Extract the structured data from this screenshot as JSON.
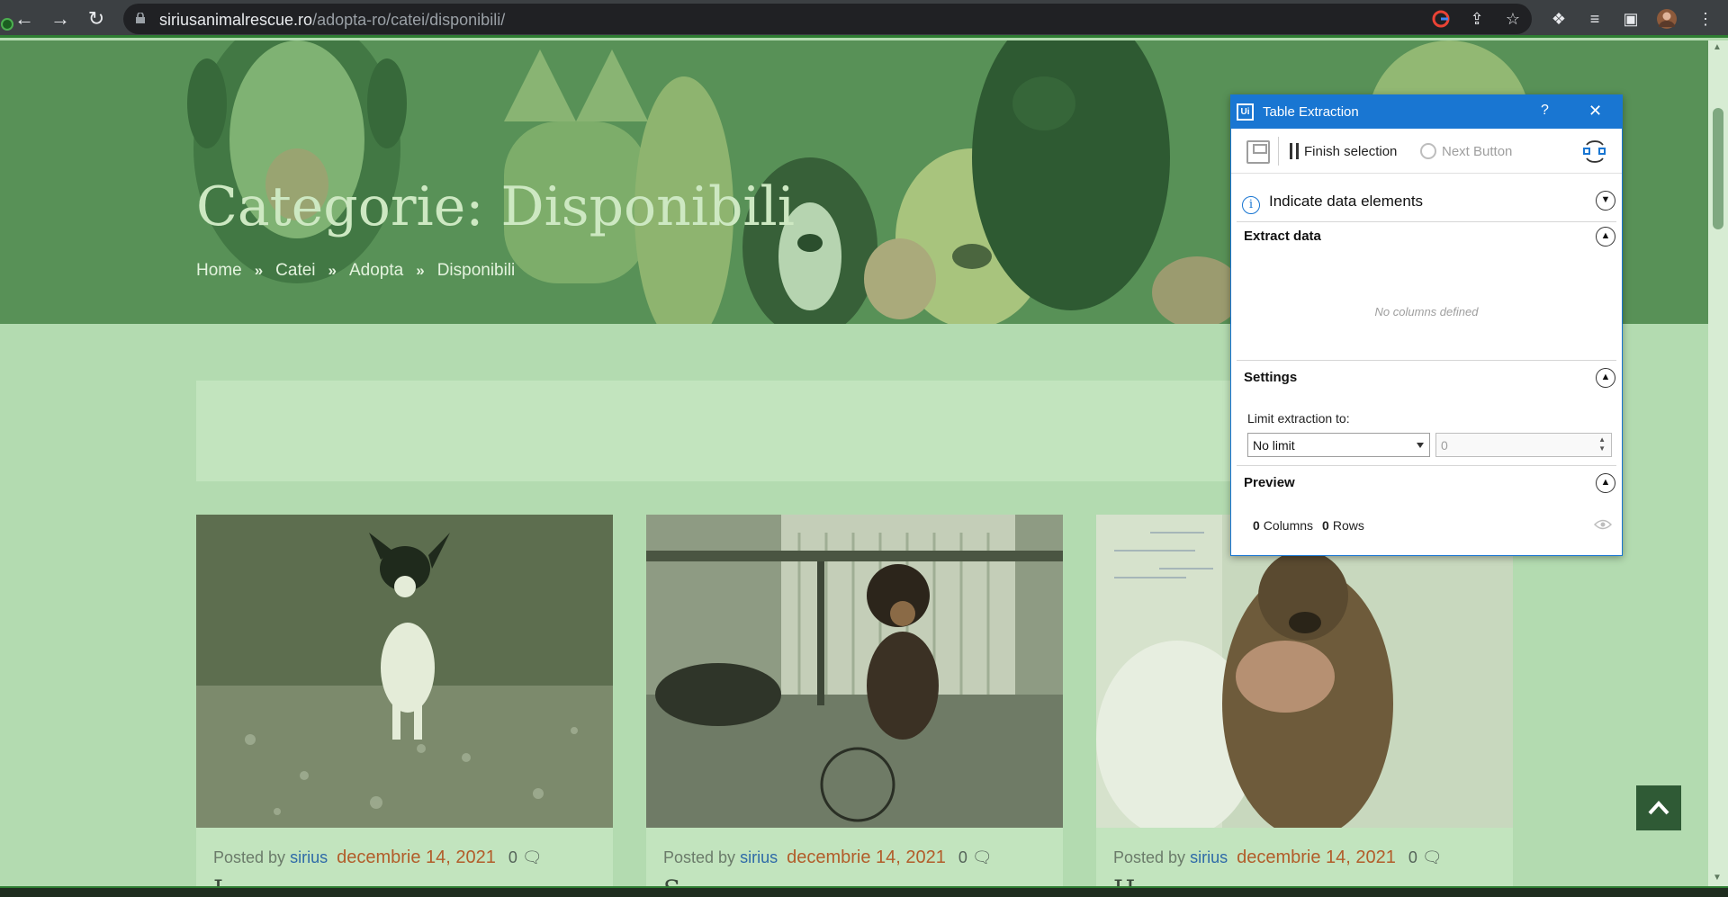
{
  "browser": {
    "url_host": "siriusanimalrescue.ro",
    "url_path": "/adopta-ro/catei/disponibili/"
  },
  "hero": {
    "title": "Categorie: Disponibili",
    "breadcrumbs": [
      "Home",
      "Catei",
      "Adopta",
      "Disponibili"
    ]
  },
  "posts": [
    {
      "posted_by": "Posted by",
      "author": "sirius",
      "date": "decembrie 14, 2021",
      "comments": "0",
      "title_start": "L"
    },
    {
      "posted_by": "Posted by",
      "author": "sirius",
      "date": "decembrie 14, 2021",
      "comments": "0",
      "title_start": "S"
    },
    {
      "posted_by": "Posted by",
      "author": "sirius",
      "date": "decembrie 14, 2021",
      "comments": "0",
      "title_start": "H"
    }
  ],
  "dialog": {
    "title": "Table Extraction",
    "help": "?",
    "finish_selection": "Finish selection",
    "next_button": "Next Button",
    "indicate": "Indicate data elements",
    "extract_data": "Extract data",
    "no_columns": "No columns defined",
    "settings": "Settings",
    "limit_label": "Limit extraction to:",
    "limit_value": "No limit",
    "limit_number": "0",
    "preview": "Preview",
    "columns_count": "0",
    "columns_label": "Columns",
    "rows_count": "0",
    "rows_label": "Rows"
  },
  "colors": {
    "overlay_green": "#b3dbb0",
    "dialog_accent": "#1976d2",
    "date_color": "#b25d2a",
    "author_color": "#2e6aa8"
  }
}
